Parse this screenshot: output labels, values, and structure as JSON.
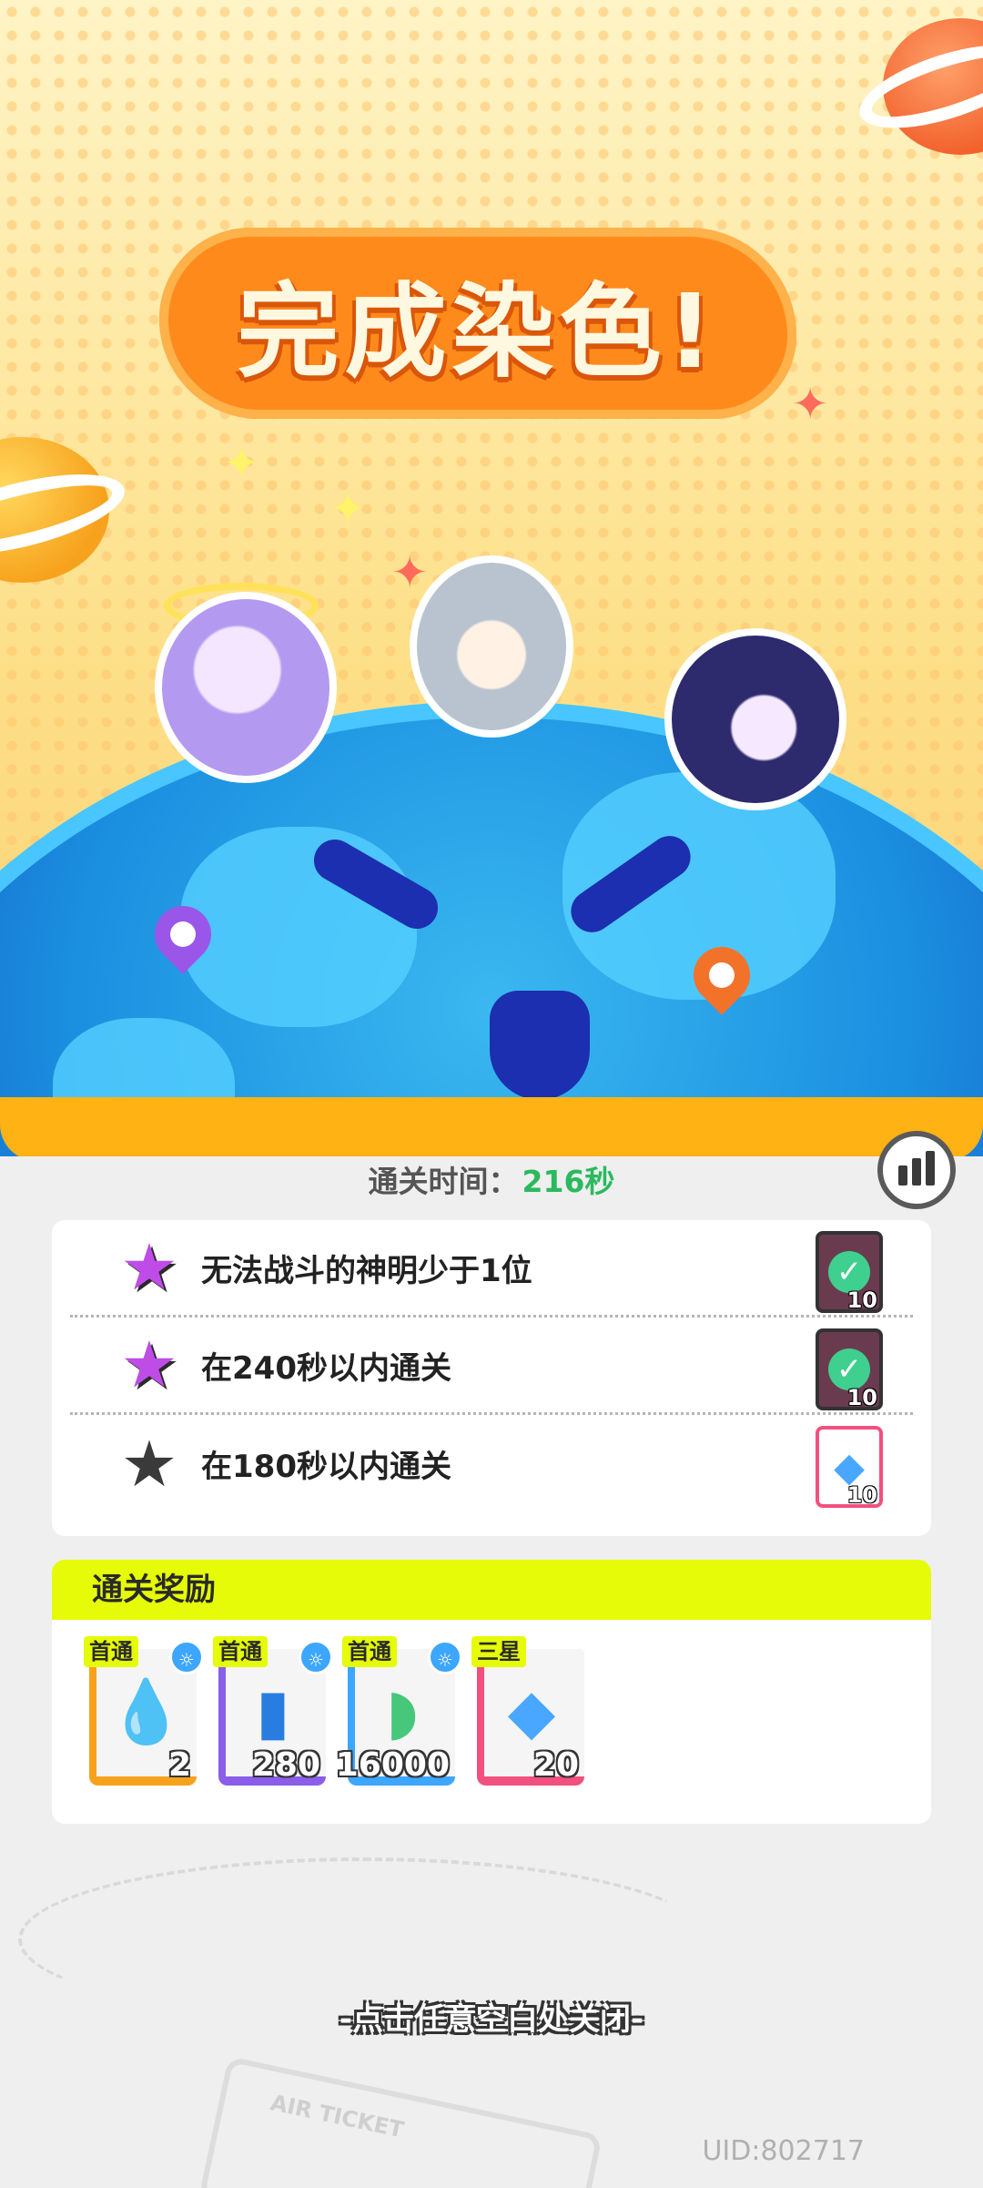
{
  "result": {
    "title": "完成染色!",
    "clear_time_label": "通关时间：",
    "clear_time_value": "216秒"
  },
  "goals": [
    {
      "text": "无法战斗的神明少于1位",
      "achieved": true,
      "reward_icon": "check-icon",
      "reward_count": "10"
    },
    {
      "text": "在240秒以内通关",
      "achieved": true,
      "reward_icon": "check-icon",
      "reward_count": "10"
    },
    {
      "text": "在180秒以内通关",
      "achieved": false,
      "reward_icon": "gem-icon",
      "reward_count": "10"
    }
  ],
  "rewards": {
    "header": "通关奖励",
    "items": [
      {
        "tag": "首通",
        "icon": "droplet-icon",
        "count": "2",
        "frame_color": "#f7a21c"
      },
      {
        "tag": "首通",
        "icon": "paint-can-icon",
        "count": "280",
        "frame_color": "#8a5ee8"
      },
      {
        "tag": "首通",
        "icon": "paint-tube-icon",
        "count": "16000",
        "frame_color": "#3da6ff"
      },
      {
        "tag": "三星",
        "icon": "gem-icon",
        "count": "20",
        "frame_color": "#f2507e"
      }
    ]
  },
  "close_hint": "-点击任意空白处关闭-",
  "uid": "UID:802717",
  "ticket_text": "AIR TICKET"
}
